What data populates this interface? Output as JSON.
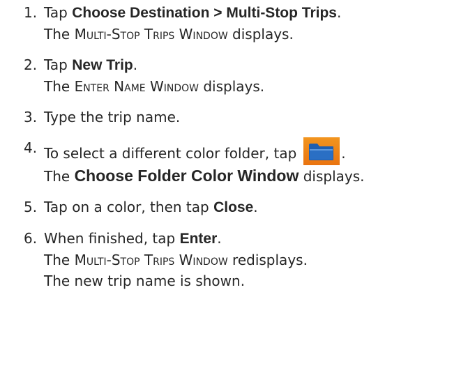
{
  "steps": [
    {
      "number": "1.",
      "lines": [
        [
          {
            "text": "Tap ",
            "style": "normal"
          },
          {
            "text": "Choose Destination > Multi-Stop Trips",
            "style": "bold"
          },
          {
            "text": ".",
            "style": "normal"
          }
        ],
        [
          {
            "text": "The ",
            "style": "normal"
          },
          {
            "text": "Multi-Stop Trips Window",
            "style": "smallcaps"
          },
          {
            "text": " displays.",
            "style": "normal"
          }
        ]
      ]
    },
    {
      "number": "2.",
      "lines": [
        [
          {
            "text": "Tap ",
            "style": "normal"
          },
          {
            "text": "New Trip",
            "style": "bold"
          },
          {
            "text": ".",
            "style": "normal"
          }
        ],
        [
          {
            "text": "The ",
            "style": "normal"
          },
          {
            "text": "Enter Name Window",
            "style": "smallcaps"
          },
          {
            "text": " displays.",
            "style": "normal"
          }
        ]
      ]
    },
    {
      "number": "3.",
      "lines": [
        [
          {
            "text": "Type the trip name.",
            "style": "normal"
          }
        ]
      ]
    },
    {
      "number": "4.",
      "lines": [
        [
          {
            "text": "To select a different color folder, tap",
            "style": "normal"
          },
          {
            "icon": "folder-color-button-icon",
            "style": "icon"
          },
          {
            "text": ".",
            "style": "normal"
          }
        ],
        [
          {
            "text": "The ",
            "style": "normal"
          },
          {
            "text": "Choose Folder Color Window",
            "style": "boldlarge"
          },
          {
            "text": " displays.",
            "style": "normal"
          }
        ]
      ]
    },
    {
      "number": "5.",
      "lines": [
        [
          {
            "text": "Tap on a color, then tap ",
            "style": "normal"
          },
          {
            "text": "Close",
            "style": "bold"
          },
          {
            "text": ".",
            "style": "normal"
          }
        ]
      ]
    },
    {
      "number": "6.",
      "lines": [
        [
          {
            "text": "When finished, tap ",
            "style": "normal"
          },
          {
            "text": "Enter",
            "style": "bold"
          },
          {
            "text": ".",
            "style": "normal"
          }
        ],
        [
          {
            "text": "The ",
            "style": "normal"
          },
          {
            "text": "Multi-Stop Trips Window",
            "style": "smallcaps"
          },
          {
            "text": " redisplays.",
            "style": "normal"
          }
        ],
        [
          {
            "text": "The new trip name is shown.",
            "style": "normal"
          }
        ]
      ]
    }
  ],
  "colors": {
    "text": "#262626",
    "icon_background": "#ef8318",
    "icon_folder": "#1f5fb0"
  }
}
